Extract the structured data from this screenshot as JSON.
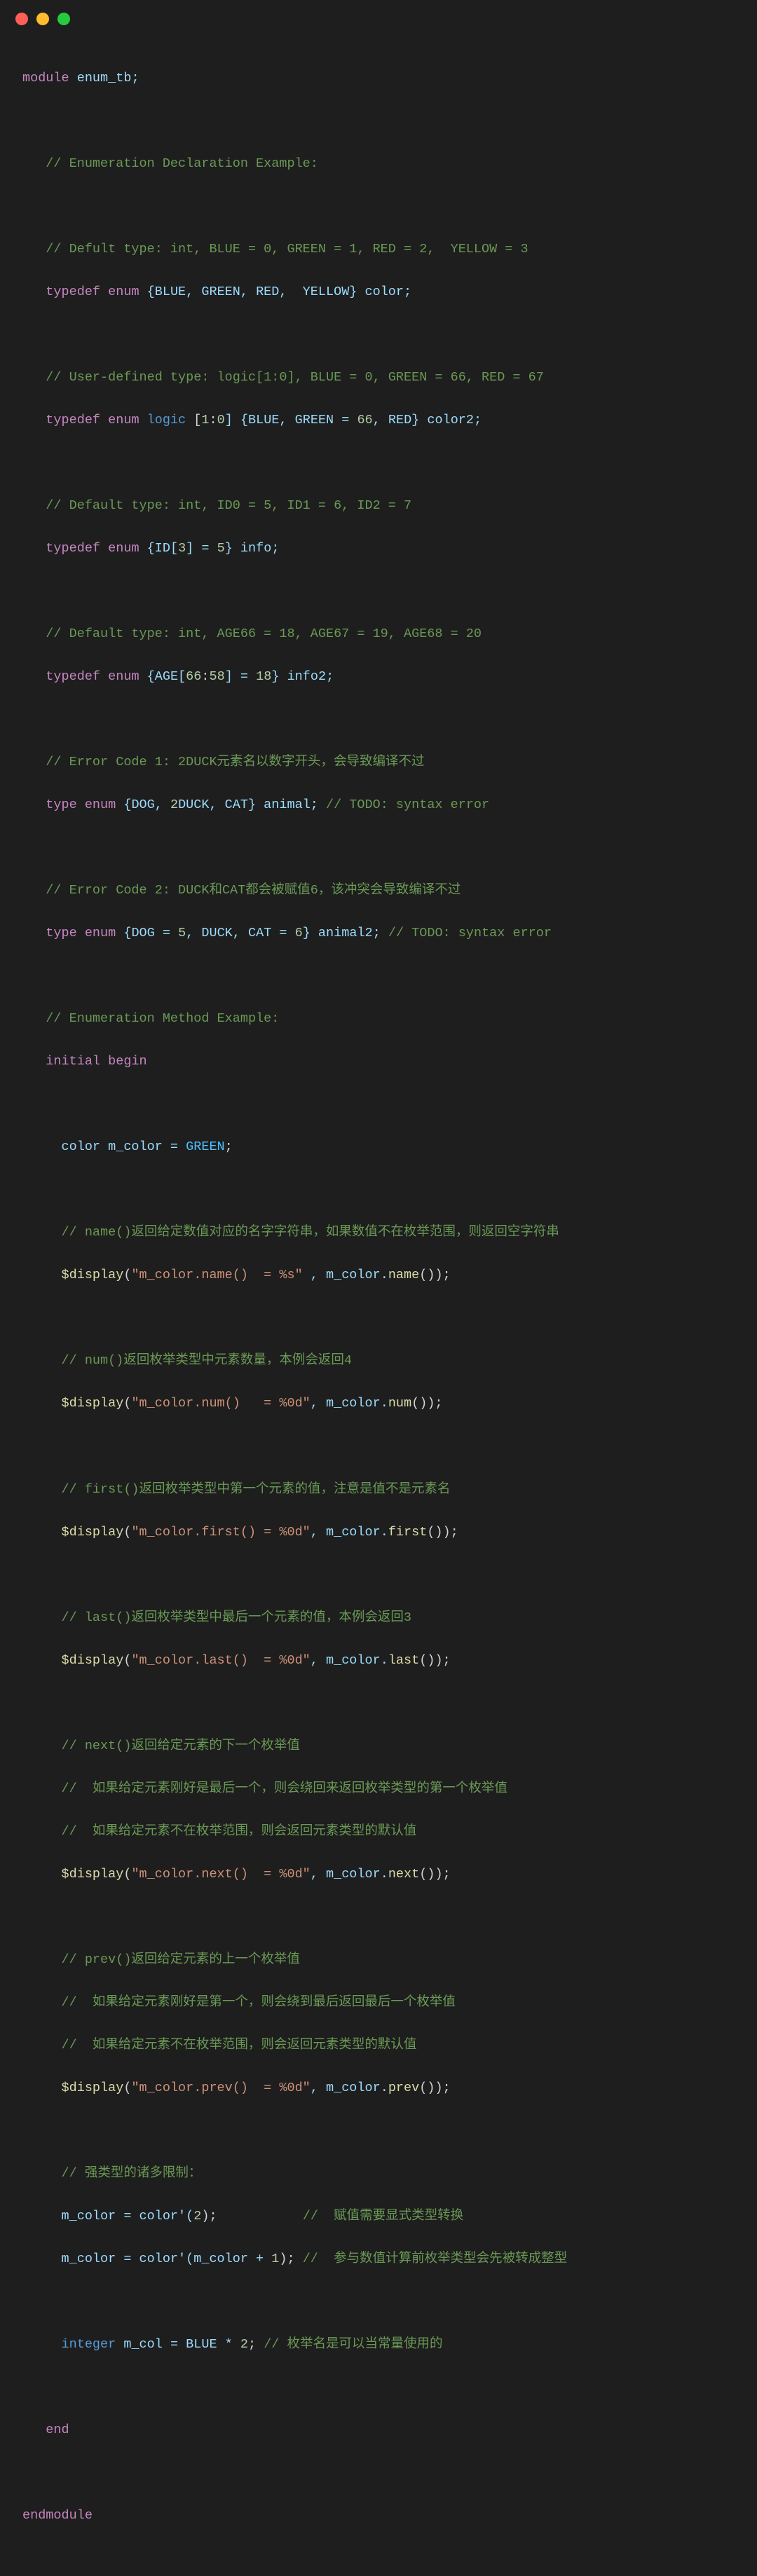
{
  "titlebar": {
    "red": "close",
    "yellow": "minimize",
    "green": "maximize"
  },
  "code": {
    "l01a": "module",
    "l01b": " enum_tb;",
    "l03": "   // Enumeration Declaration Example:",
    "l05": "   // Defult type: int, BLUE = 0, GREEN = 1, RED = 2,  YELLOW = 3",
    "l06a": "   typedef",
    "l06b": " enum",
    "l06c": " {BLUE, GREEN, RED,  YELLOW} color;",
    "l08": "   // User-defined type: logic[1:0], BLUE = 0, GREEN = 66, RED = 67",
    "l09a": "   typedef",
    "l09b": " enum",
    "l09c": " logic",
    "l09d": " [",
    "l09e": "1",
    "l09f": ":",
    "l09g": "0",
    "l09h": "] {BLUE, GREEN = ",
    "l09i": "66",
    "l09j": ", RED} color2;",
    "l11": "   // Default type: int, ID0 = 5, ID1 = 6, ID2 = 7",
    "l12a": "   typedef",
    "l12b": " enum",
    "l12c": " {ID[",
    "l12d": "3",
    "l12e": "] = ",
    "l12f": "5",
    "l12g": "} info;",
    "l14": "   // Default type: int, AGE66 = 18, AGE67 = 19, AGE68 = 20",
    "l15a": "   typedef",
    "l15b": " enum",
    "l15c": " {AGE[",
    "l15d": "66",
    "l15e": ":",
    "l15f": "58",
    "l15g": "] = ",
    "l15h": "18",
    "l15i": "} info2;",
    "l17": "   // Error Code 1: 2DUCK元素名以数字开头，会导致编译不过",
    "l18a": "   type",
    "l18b": " enum",
    "l18c": " {DOG, ",
    "l18d": "2",
    "l18e": "DUCK, CAT} animal; ",
    "l18f": "// TODO: syntax error",
    "l20": "   // Error Code 2: DUCK和CAT都会被赋值6，该冲突会导致编译不过",
    "l21a": "   type",
    "l21b": " enum",
    "l21c": " {DOG = ",
    "l21d": "5",
    "l21e": ", DUCK, CAT = ",
    "l21f": "6",
    "l21g": "} animal2; ",
    "l21h": "// TODO: syntax error",
    "l23": "   // Enumeration Method Example:",
    "l24a": "   initial",
    "l24b": " begin",
    "l26a": "     color m_color = ",
    "l26b": "GREEN",
    "l26c": ";",
    "l28": "     // name()返回给定数值对应的名字字符串，如果数值不在枚举范围，则返回空字符串",
    "l29a": "     $display",
    "l29b": "(",
    "l29c": "\"m_color.name()  = %s\"",
    "l29d": " , m_color.",
    "l29e": "name",
    "l29f": "());",
    "l31": "     // num()返回枚举类型中元素数量，本例会返回4",
    "l32a": "     $display",
    "l32b": "(",
    "l32c": "\"m_color.num()   = %0d\"",
    "l32d": ", m_color.",
    "l32e": "num",
    "l32f": "());",
    "l34": "     // first()返回枚举类型中第一个元素的值，注意是值不是元素名",
    "l35a": "     $display",
    "l35b": "(",
    "l35c": "\"m_color.first() = %0d\"",
    "l35d": ", m_color.",
    "l35e": "first",
    "l35f": "());",
    "l37": "     // last()返回枚举类型中最后一个元素的值，本例会返回3",
    "l38a": "     $display",
    "l38b": "(",
    "l38c": "\"m_color.last()  = %0d\"",
    "l38d": ", m_color.",
    "l38e": "last",
    "l38f": "());",
    "l40": "     // next()返回给定元素的下一个枚举值",
    "l41": "     //  如果给定元素刚好是最后一个，则会绕回来返回枚举类型的第一个枚举值",
    "l42": "     //  如果给定元素不在枚举范围，则会返回元素类型的默认值",
    "l43a": "     $display",
    "l43b": "(",
    "l43c": "\"m_color.next()  = %0d\"",
    "l43d": ", m_color.",
    "l43e": "next",
    "l43f": "());",
    "l45": "     // prev()返回给定元素的上一个枚举值",
    "l46": "     //  如果给定元素刚好是第一个，则会绕到最后返回最后一个枚举值",
    "l47": "     //  如果给定元素不在枚举范围，则会返回元素类型的默认值",
    "l48a": "     $display",
    "l48b": "(",
    "l48c": "\"m_color.prev()  = %0d\"",
    "l48d": ", m_color.",
    "l48e": "prev",
    "l48f": "());",
    "l50": "     // 强类型的诸多限制：",
    "l51a": "     m_color = color'(",
    "l51b": "2",
    "l51c": ");           ",
    "l51d": "//  赋值需要显式类型转换",
    "l52a": "     m_color = color'(m_color + ",
    "l52b": "1",
    "l52c": "); ",
    "l52d": "//  参与数值计算前枚举类型会先被转成整型",
    "l54a": "     integer",
    "l54b": " m_col = BLUE * ",
    "l54c": "2",
    "l54d": "; ",
    "l54e": "// 枚举名是可以当常量使用的",
    "l56a": "   end",
    "l58": "endmodule"
  }
}
